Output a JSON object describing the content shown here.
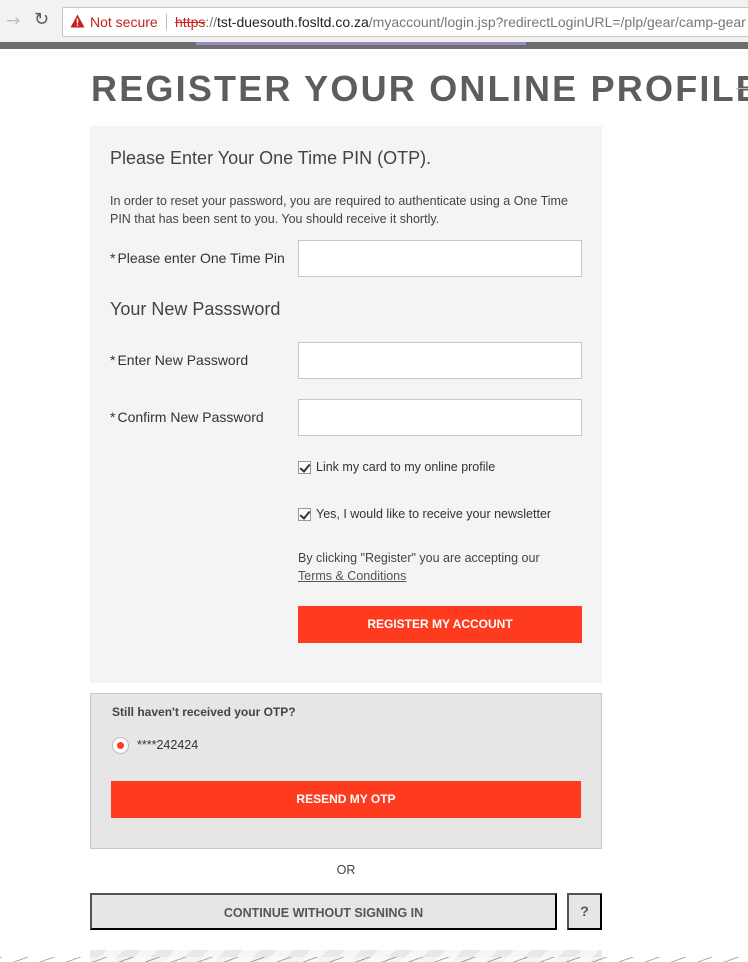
{
  "browser": {
    "security_label": "Not secure",
    "url_scheme": "https",
    "url_host": "tst-duesouth.fosltd.co.za",
    "url_rest": "/myaccount/login.jsp?redirectLoginURL=/plp/gear/camp-gear"
  },
  "page": {
    "title": "REGISTER YOUR ONLINE PROFILE"
  },
  "otp_form": {
    "heading": "Please Enter Your One Time PIN (OTP).",
    "description": "In order to reset your password, you are required to authenticate using a One Time PIN that has been sent to you. You should receive it shortly.",
    "otp_label": "Please enter One Time Pin",
    "password_section_heading": "Your New Passsword",
    "new_password_label": "Enter New Password",
    "confirm_password_label": "Confirm New Password",
    "required_marker": "*",
    "link_card_label": "Link my card to my online profile",
    "link_card_checked": true,
    "newsletter_label": "Yes, I would like to receive your newsletter",
    "newsletter_checked": true,
    "accept_text": "By clicking \"Register\" you are accepting our",
    "terms_link": "Terms & Conditions",
    "register_button": "REGISTER MY ACCOUNT"
  },
  "resend": {
    "heading": "Still haven't received your OTP?",
    "phone_masked": "****242424",
    "phone_selected": true,
    "resend_button": "RESEND MY OTP"
  },
  "or_text": "OR",
  "continue_button": "CONTINUE WITHOUT SIGNING IN",
  "help_button": "?",
  "colors": {
    "accent": "#ff3b1f",
    "panel": "#f4f4f4",
    "title": "#5d5d5d"
  }
}
